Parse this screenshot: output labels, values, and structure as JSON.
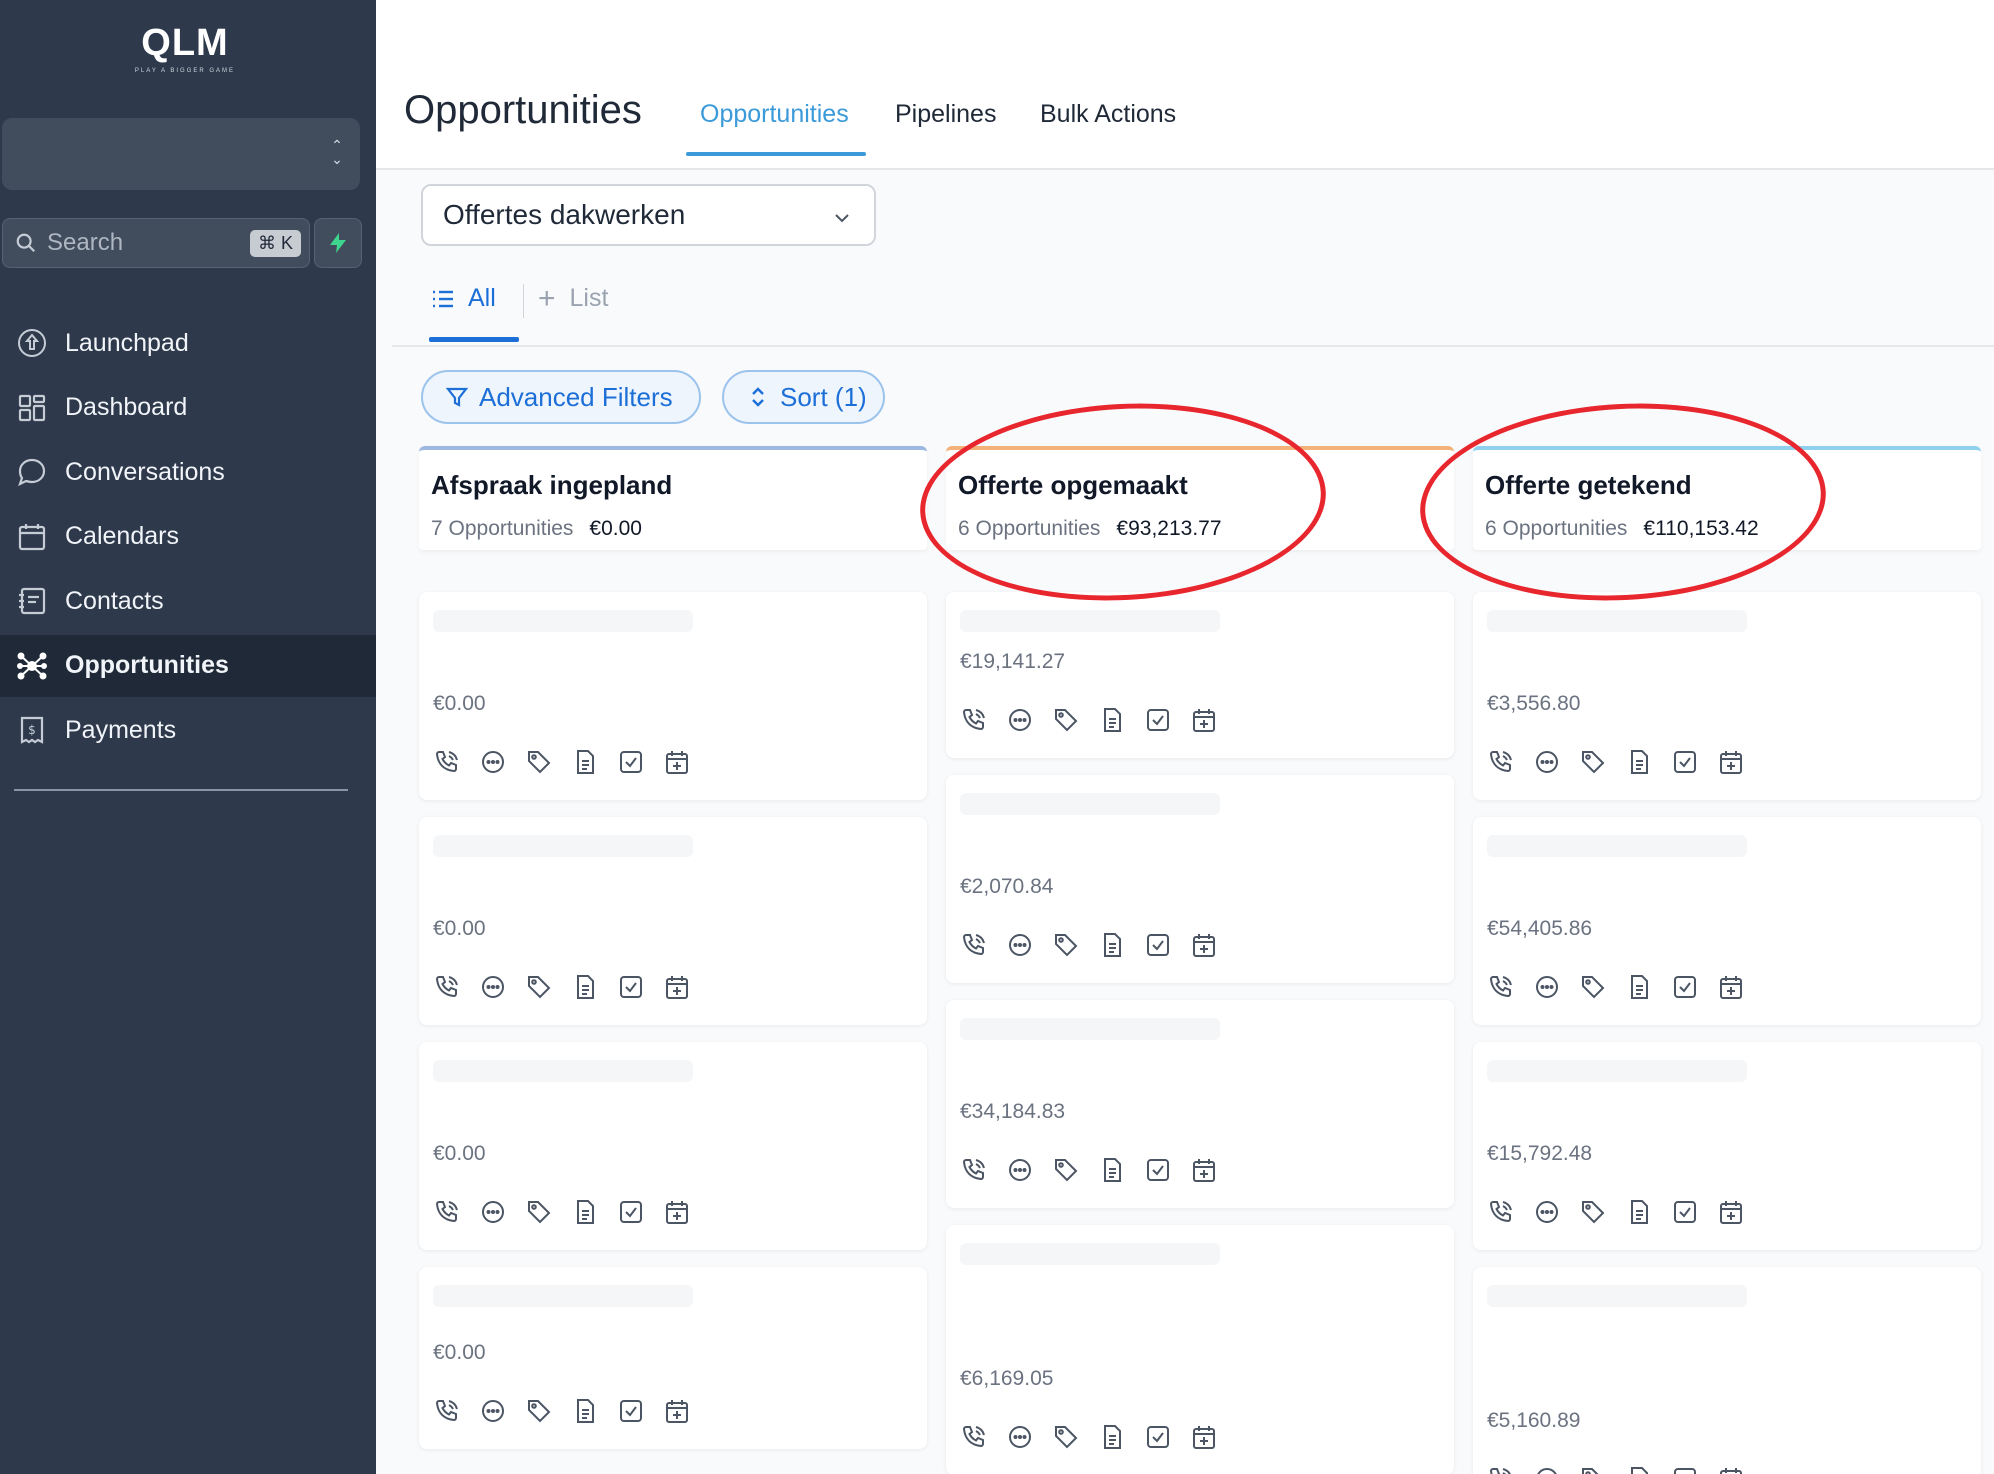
{
  "sidebar": {
    "logo": {
      "mark": "QLM",
      "tagline": "PLAY A BIGGER GAME"
    },
    "search": {
      "placeholder": "Search",
      "shortcut": "⌘ K"
    },
    "nav": [
      {
        "label": "Launchpad",
        "icon": "rocket-icon",
        "active": false
      },
      {
        "label": "Dashboard",
        "icon": "grid-icon",
        "active": false
      },
      {
        "label": "Conversations",
        "icon": "chat-bubble-icon",
        "active": false
      },
      {
        "label": "Calendars",
        "icon": "calendar-icon",
        "active": false
      },
      {
        "label": "Contacts",
        "icon": "contact-book-icon",
        "active": false
      },
      {
        "label": "Opportunities",
        "icon": "network-icon",
        "active": true
      },
      {
        "label": "Payments",
        "icon": "receipt-icon",
        "active": false
      }
    ]
  },
  "header": {
    "title": "Opportunities",
    "tabs": [
      {
        "label": "Opportunities",
        "active": true
      },
      {
        "label": "Pipelines",
        "active": false
      },
      {
        "label": "Bulk Actions",
        "active": false
      }
    ]
  },
  "pipeline": {
    "selected": "Offertes dakwerken"
  },
  "views": {
    "all": "All",
    "add_list": "List"
  },
  "filters": {
    "advanced": "Advanced Filters",
    "sort": "Sort (1)"
  },
  "colors": {
    "accent": "#1d6fd8",
    "sidebar": "#2e3a4b",
    "highlight": "#e8262d"
  },
  "columns": [
    {
      "title": "Afspraak ingepland",
      "count": "7 Opportunities",
      "value": "€0.00",
      "color": "#9cb8e0",
      "cards": [
        {
          "amount": "€0.00"
        },
        {
          "amount": "€0.00"
        },
        {
          "amount": "€0.00"
        },
        {
          "amount": "€0.00"
        }
      ]
    },
    {
      "title": "Offerte opgemaakt",
      "count": "6 Opportunities",
      "value": "€93,213.77",
      "color": "#f2b27a",
      "cards": [
        {
          "amount": "€19,141.27"
        },
        {
          "amount": "€2,070.84"
        },
        {
          "amount": "€34,184.83"
        },
        {
          "amount": "€6,169.05"
        }
      ]
    },
    {
      "title": "Offerte getekend",
      "count": "6 Opportunities",
      "value": "€110,153.42",
      "color": "#8fd0ef",
      "cards": [
        {
          "amount": "€3,556.80"
        },
        {
          "amount": "€54,405.86"
        },
        {
          "amount": "€15,792.48"
        },
        {
          "amount": "€5,160.89"
        }
      ]
    }
  ]
}
